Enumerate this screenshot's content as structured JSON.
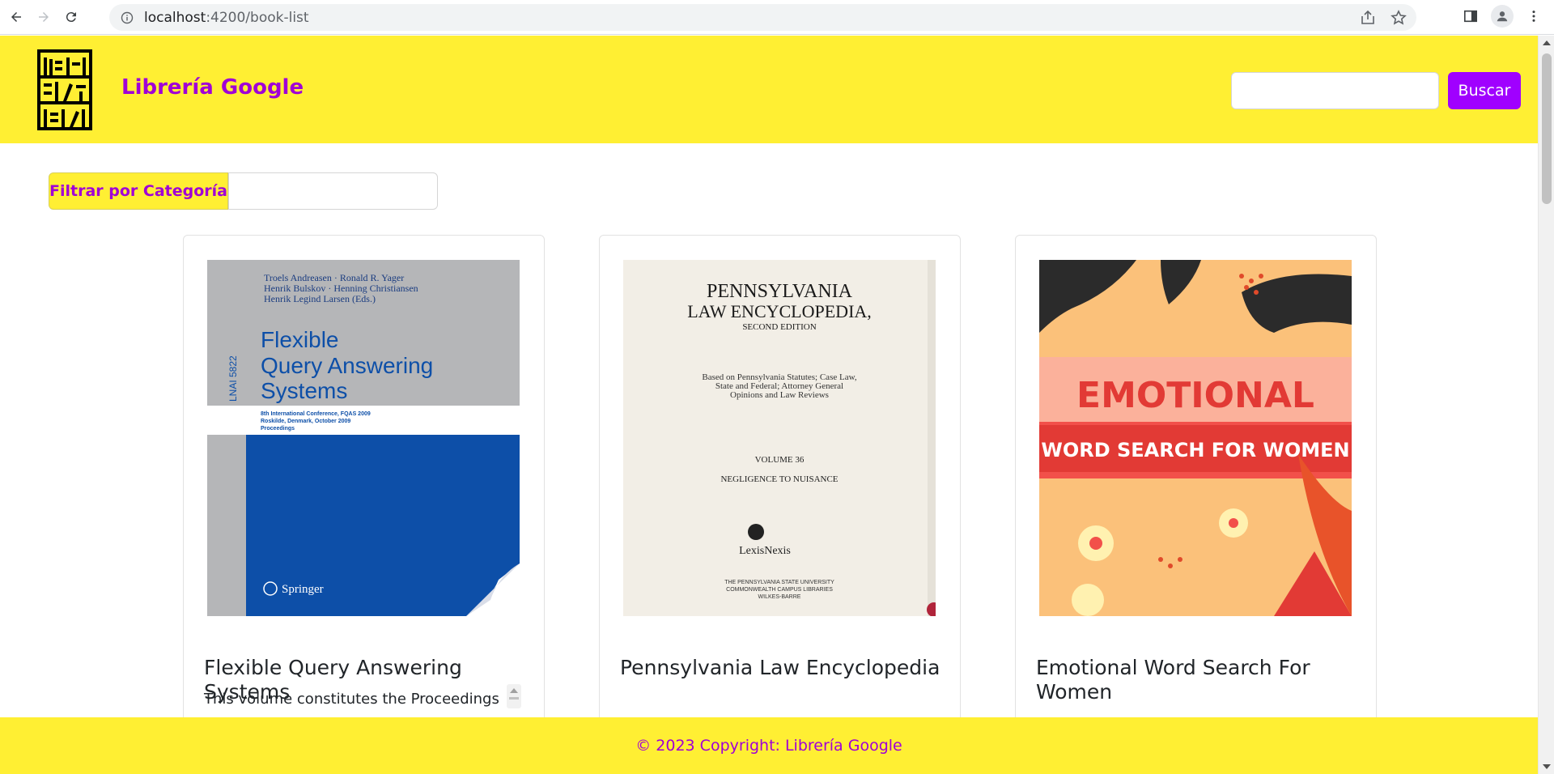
{
  "browser": {
    "url_host": "localhost",
    "url_path": ":4200/book-list"
  },
  "header": {
    "brand": "Librería Google",
    "search_placeholder": "",
    "search_button": "Buscar"
  },
  "filter": {
    "label": "Filtrar por Categoría",
    "value": ""
  },
  "books": [
    {
      "title": "Flexible Query Answering Systems",
      "description": "This volume constitutes the Proceedings",
      "cover": {
        "authors": [
          "Troels Andreasen · Ronald R. Yager",
          "Henrik Bulskov · Henning Christiansen",
          "Henrik Legind Larsen (Eds.)"
        ],
        "title_lines": [
          "Flexible",
          "Query Answering",
          "Systems"
        ],
        "side_label": "LNAI 5822",
        "subtitle": [
          "8th International Conference, FQAS 2009",
          "Roskilde, Denmark, October 2009",
          "Proceedings"
        ],
        "publisher": "Springer"
      }
    },
    {
      "title": "Pennsylvania Law Encyclopedia",
      "description": "",
      "cover": {
        "title_lines": [
          "PENNSYLVANIA",
          "LAW ENCYCLOPEDIA,",
          "SECOND EDITION"
        ],
        "body": [
          "Based on Pennsylvania Statutes; Case Law,",
          "State and Federal; Attorney General",
          "Opinions and Law Reviews"
        ],
        "volume": "VOLUME 36",
        "range": "NEGLIGENCE TO NUISANCE",
        "publisher": "LexisNexis",
        "stamp": [
          "THE PENNSYLVANIA STATE UNIVERSITY",
          "COMMONWEALTH CAMPUS LIBRARIES",
          "WILKES-BARRE"
        ]
      }
    },
    {
      "title": "Emotional Word Search For Women",
      "description": "",
      "cover": {
        "title": "EMOTIONAL",
        "subtitle": "WORD SEARCH FOR WOMEN"
      }
    }
  ],
  "footer": {
    "copyright": "© 2023 Copyright: Librería Google"
  },
  "colors": {
    "brand_yellow": "#ffef33",
    "brand_purple": "#a000d6",
    "button_purple": "#a000ff"
  }
}
